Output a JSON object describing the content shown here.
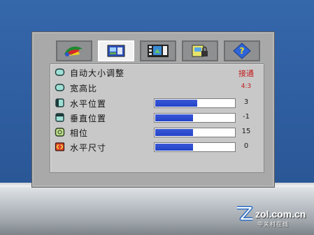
{
  "menu": {
    "tabs": [
      {
        "icon": "color-palette-icon"
      },
      {
        "icon": "image-settings-icon"
      },
      {
        "icon": "video-adjust-icon"
      },
      {
        "icon": "setup-lock-icon"
      },
      {
        "icon": "help-icon"
      }
    ],
    "active_tab": 1,
    "rows": [
      {
        "icon": "rounded-rect-icon",
        "label": "自动大小调整",
        "value": "接通"
      },
      {
        "icon": "rounded-rect-icon",
        "label": "宽高比",
        "value": "4:3"
      },
      {
        "icon": "horizontal-position-icon",
        "label": "水平位置",
        "value": "3",
        "level": 0.54
      },
      {
        "icon": "vertical-position-icon",
        "label": "垂直位置",
        "value": "-1",
        "level": 0.49
      },
      {
        "icon": "phase-icon",
        "label": "相位",
        "value": "15",
        "level": 0.49
      },
      {
        "icon": "horizontal-size-icon",
        "label": "水平尺寸",
        "value": "0",
        "level": 0.49
      }
    ]
  },
  "watermark": {
    "text": "zol.com.cn",
    "subtext": "中关村在线"
  },
  "colors": {
    "accent_red": "#c21b1b",
    "bar_fill": "#2343c8"
  }
}
